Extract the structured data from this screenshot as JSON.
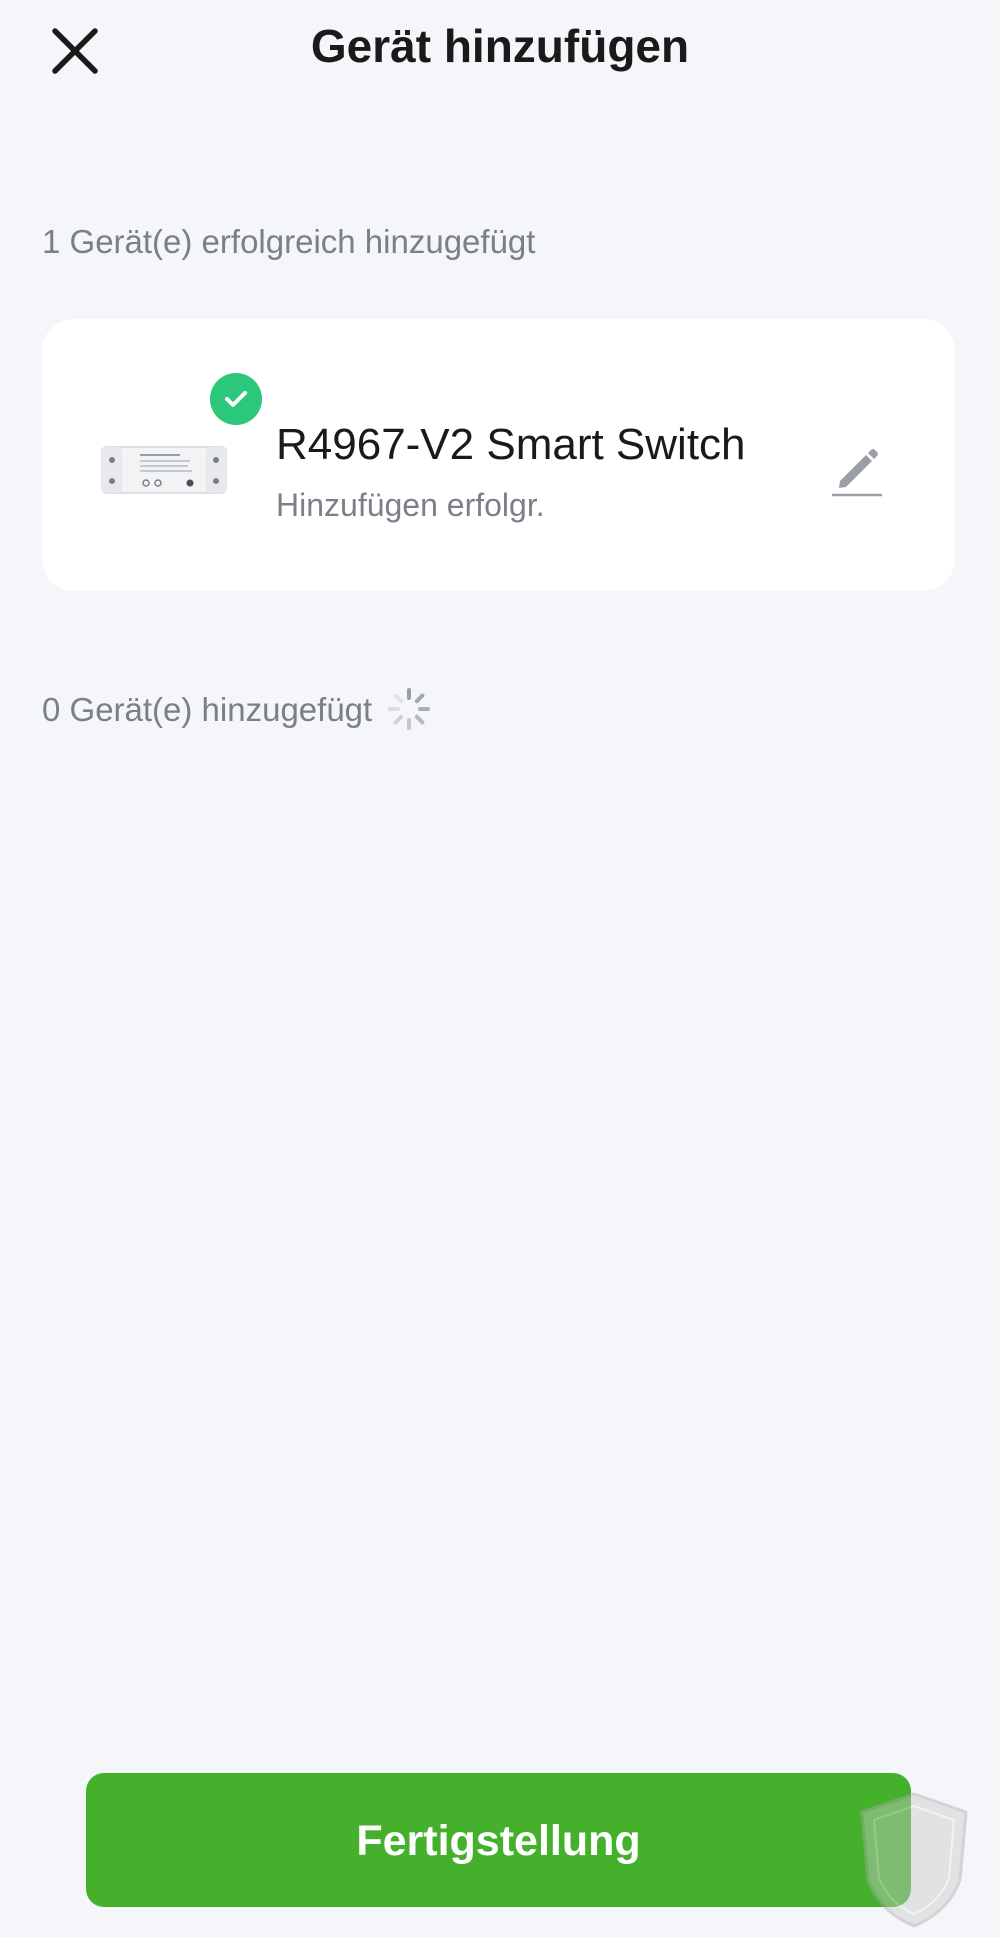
{
  "header": {
    "title": "Gerät hinzufügen",
    "close_icon": "close-icon"
  },
  "success_section": {
    "label": "1 Gerät(e) erfolgreich hinzugefügt"
  },
  "device_card": {
    "name": "R4967-V2 Smart Switch",
    "status": "Hinzufügen erfolgr.",
    "image_icon": "smart-switch-device-image",
    "badge_icon": "check-circle-icon",
    "edit_icon": "pencil-icon"
  },
  "pending_section": {
    "label": "0 Gerät(e) hinzugefügt",
    "spinner_icon": "loading-spinner-icon"
  },
  "footer": {
    "done_label": "Fertigstellung"
  },
  "colors": {
    "background": "#f5f6fa",
    "accent_green": "#44b02c",
    "success_badge": "#2bc77a",
    "secondary_text": "#7b7f87"
  }
}
